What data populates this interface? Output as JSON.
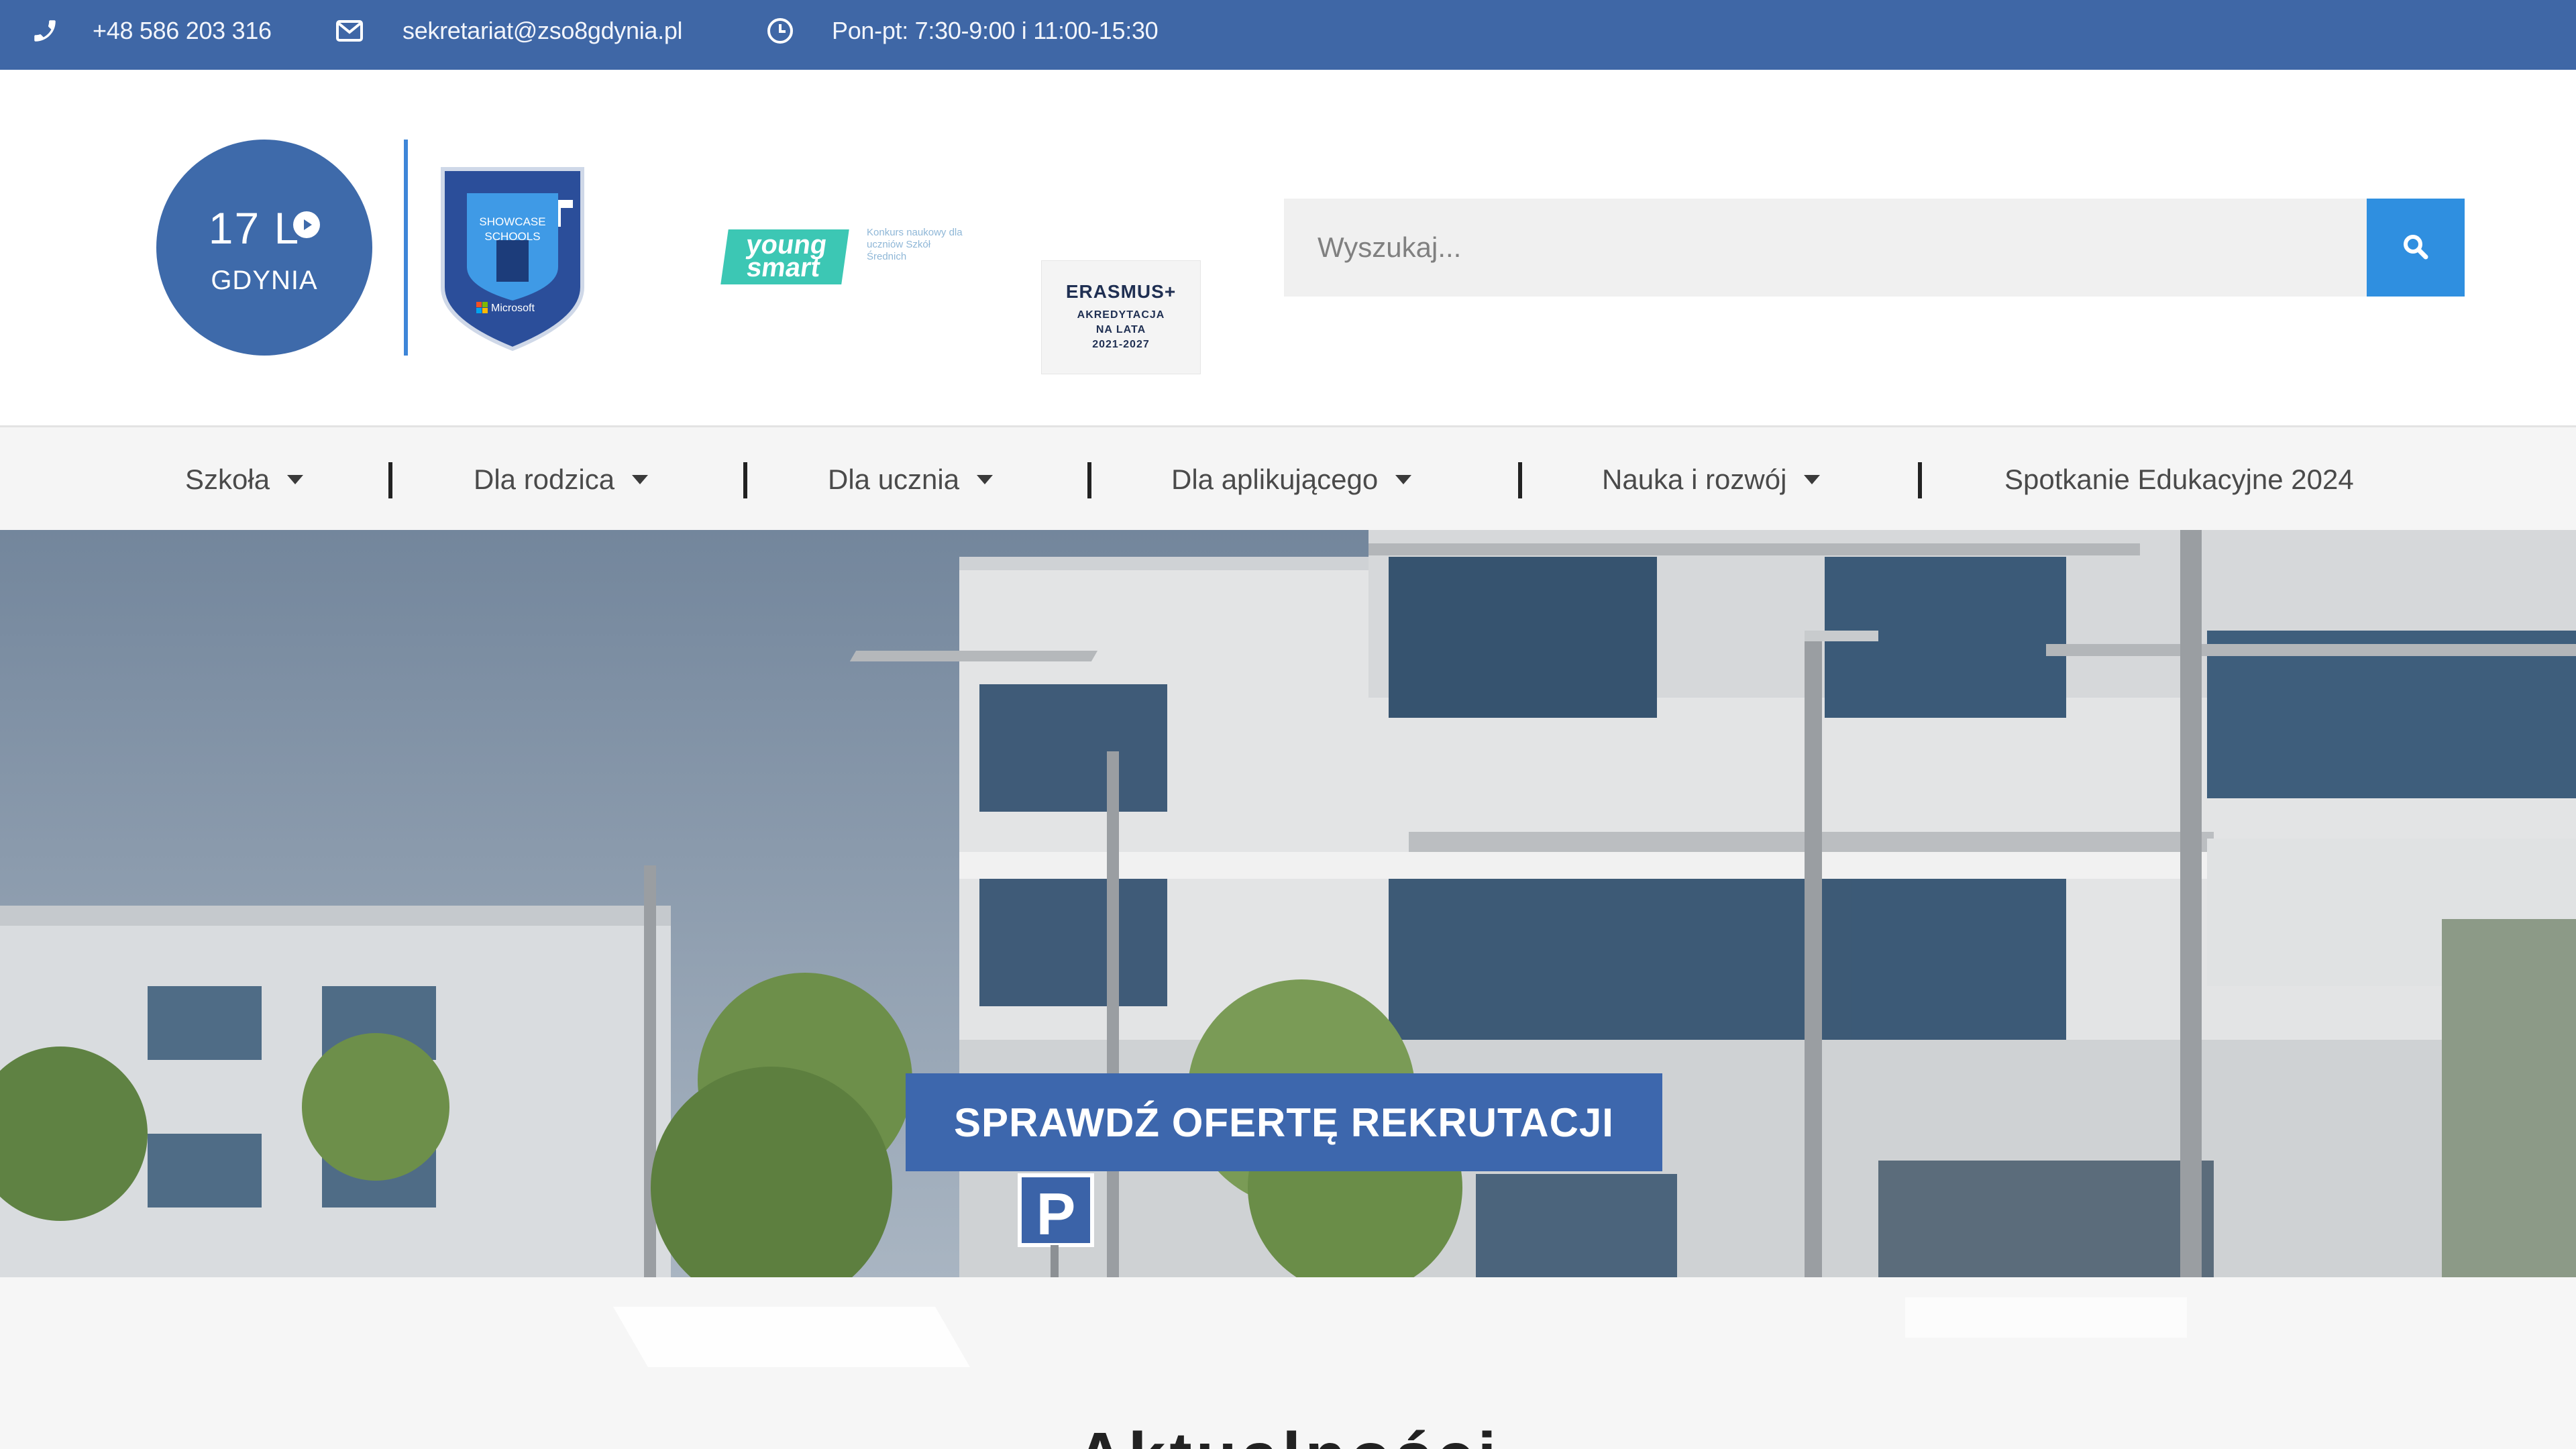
{
  "topbar": {
    "phone": "+48 586 203 316",
    "email": "sekretariat@zso8gdynia.pl",
    "hours": "Pon-pt:  7:30-9:00  i  11:00-15:30"
  },
  "logo": {
    "main": "17 L",
    "city": "GDYNIA"
  },
  "partners": {
    "showcase_line1": "SHOWCASE",
    "showcase_line2": "SCHOOLS",
    "showcase_brand": "Microsoft",
    "young_smart_line1": "young",
    "young_smart_line2": "smart",
    "young_smart_note": "Konkurs naukowy dla uczniów Szkół Średnich",
    "erasmus_title": "ERASMUS+",
    "erasmus_line1": "AKREDYTACJA",
    "erasmus_line2": "NA LATA",
    "erasmus_line3": "2021-2027"
  },
  "search": {
    "placeholder": "Wyszukaj..."
  },
  "nav": {
    "items": [
      {
        "label": "Szkoła"
      },
      {
        "label": "Dla rodzica"
      },
      {
        "label": "Dla ucznia"
      },
      {
        "label": "Dla aplikującego"
      },
      {
        "label": "Nauka i rozwój"
      },
      {
        "label": "Spotkanie Edukacyjne 2024"
      }
    ]
  },
  "hero": {
    "cta_label": "SPRAWDŹ OFERTĘ REKRUTACJI",
    "parking_sign": "P"
  },
  "section": {
    "title_partial": "Aktualności"
  },
  "colors": {
    "topbar": "#3f67a6",
    "brand": "#3e6aaa",
    "search_button": "#2f8fe0",
    "cta": "#3d67ad"
  }
}
